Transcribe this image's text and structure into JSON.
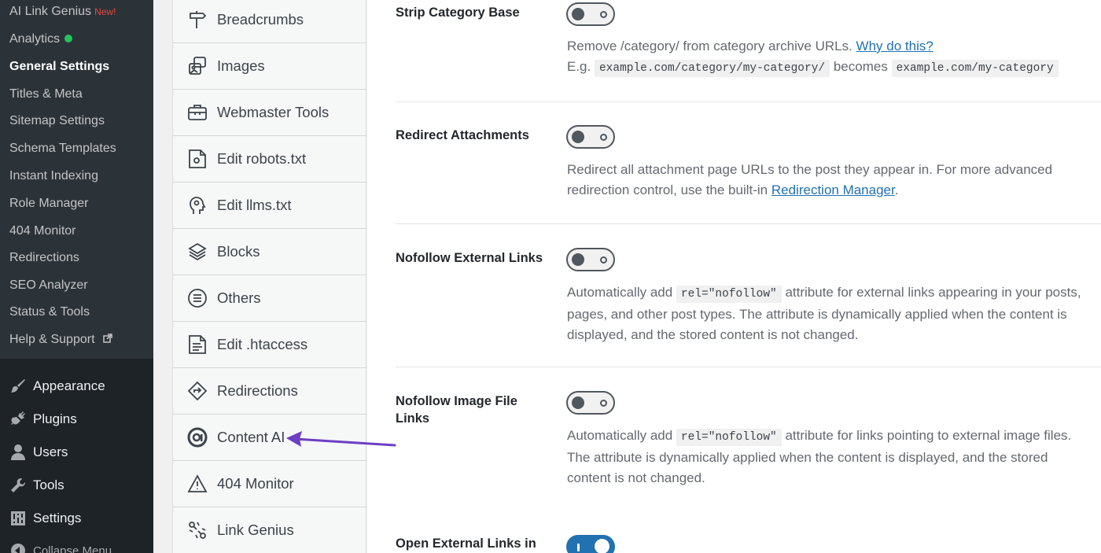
{
  "submenu": {
    "items": [
      {
        "label": "AI Link Genius",
        "badge": "New!"
      },
      {
        "label": "Analytics"
      },
      {
        "label": "General Settings"
      },
      {
        "label": "Titles & Meta"
      },
      {
        "label": "Sitemap Settings"
      },
      {
        "label": "Schema Templates"
      },
      {
        "label": "Instant Indexing"
      },
      {
        "label": "Role Manager"
      },
      {
        "label": "404 Monitor"
      },
      {
        "label": "Redirections"
      },
      {
        "label": "SEO Analyzer"
      },
      {
        "label": "Status & Tools"
      },
      {
        "label": "Help & Support"
      }
    ]
  },
  "menu": {
    "items": [
      {
        "label": "Appearance",
        "icon": "paintbrush-icon"
      },
      {
        "label": "Plugins",
        "icon": "plug-icon"
      },
      {
        "label": "Users",
        "icon": "user-icon"
      },
      {
        "label": "Tools",
        "icon": "wrench-icon"
      },
      {
        "label": "Settings",
        "icon": "settings-icon"
      },
      {
        "label": "Collapse Menu",
        "icon": "collapse-icon"
      }
    ]
  },
  "module_nav": {
    "items": [
      {
        "label": "Breadcrumbs",
        "icon": "signpost-icon"
      },
      {
        "label": "Images",
        "icon": "images-icon"
      },
      {
        "label": "Webmaster Tools",
        "icon": "toolbox-icon"
      },
      {
        "label": "Edit robots.txt",
        "icon": "robots-file-icon"
      },
      {
        "label": "Edit llms.txt",
        "icon": "llms-head-icon"
      },
      {
        "label": "Blocks",
        "icon": "blocks-icon"
      },
      {
        "label": "Others",
        "icon": "list-circle-icon"
      },
      {
        "label": "Edit .htaccess",
        "icon": "htaccess-file-icon"
      },
      {
        "label": "Redirections",
        "icon": "redirect-diamond-icon"
      },
      {
        "label": "Content AI",
        "icon": "content-ai-icon"
      },
      {
        "label": "404 Monitor",
        "icon": "warning-triangle-icon"
      },
      {
        "label": "Link Genius",
        "icon": "link-genius-icon"
      }
    ]
  },
  "settings": {
    "strip_category": {
      "label": "Strip Category Base",
      "enabled": false,
      "desc_text": "Remove /category/ from category archive URLs. ",
      "desc_link": "Why do this?",
      "eg_prefix": "E.g. ",
      "eg_code1": "example.com/category/my-category/",
      "eg_mid": " becomes ",
      "eg_code2": "example.com/my-category"
    },
    "redirect_attachments": {
      "label": "Redirect Attachments",
      "enabled": false,
      "desc_text": "Redirect all attachment page URLs to the post they appear in. For more advanced redirection control, use the built-in ",
      "desc_link": "Redirection Manager",
      "desc_end": "."
    },
    "nofollow_external": {
      "label": "Nofollow External Links",
      "enabled": false,
      "desc_pre": "Automatically add ",
      "code": "rel=\"nofollow\"",
      "desc_post": " attribute for external links appearing in your posts, pages, and other post types. The attribute is dynamically applied when the content is displayed, and the stored content is not changed."
    },
    "nofollow_image": {
      "label": "Nofollow Image File Links",
      "enabled": false,
      "desc_pre": "Automatically add ",
      "code": "rel=\"nofollow\"",
      "desc_post": " attribute for links pointing to external image files. The attribute is dynamically applied when the content is displayed, and the stored content is not changed."
    },
    "open_external": {
      "label": "Open External Links in",
      "enabled": true
    }
  },
  "colors": {
    "admin_bg": "#1d2327",
    "submenu_bg": "#2c3338",
    "accent": "#2271b1",
    "annotation_arrow": "#6c3fc4",
    "new_badge": "#e5483f",
    "status_dot": "#23c45e"
  }
}
